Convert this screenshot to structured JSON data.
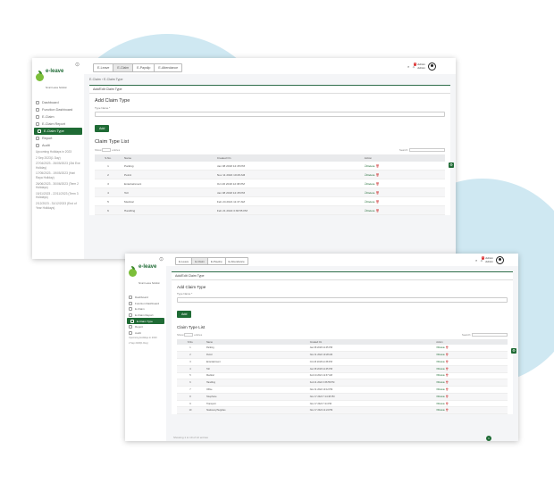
{
  "brand": {
    "name": "e-leave",
    "tagline": "Smart Leave Solution",
    "accent": "#1f6b35",
    "blob": "#cfe8f2"
  },
  "sidebar": {
    "items": [
      {
        "label": "Dashboard",
        "icon": "dashboard-icon"
      },
      {
        "label": "Function Dashboard",
        "icon": "clock-icon"
      },
      {
        "label": "E-Claim",
        "icon": "document-icon"
      },
      {
        "label": "E-Claim Report",
        "icon": "report-icon"
      },
      {
        "label": "E-Claim Type",
        "icon": "list-icon",
        "active": true
      },
      {
        "label": "Report",
        "icon": "chart-icon"
      },
      {
        "label": "Audit",
        "icon": "audit-icon"
      }
    ],
    "holiday_header": "Upcoming Holidays in 2023",
    "holidays": [
      "2 Sep 2023(1 Day)",
      "27/04/2023 - 26/05/2023 (Old Eve Holiday)",
      "17/05/2023 - 19/05/2023 (Hari Raya Holiday)",
      "26/06/2023 - 30/06/2023 (Term 2 Holidays)",
      "15/11/2023 - 22/11/2023 (Term 3 Holidays)",
      "2/12/2023 - 31/12/2023 (End of Year Holidays)"
    ]
  },
  "topbar": {
    "tabs": [
      "E-Leave",
      "E-Claim",
      "E-Payslip",
      "E-Attendance"
    ],
    "active_tab": 1,
    "search_icon": "search-icon",
    "bell_icon": "bell-icon",
    "badge": "1",
    "user_name": "Admin",
    "user_role": "Admin"
  },
  "breadcrumb": "E-Claim  ›  E-Claim Type",
  "card_header": "Add/Edit Claim Type",
  "form": {
    "title": "Add Claim Type",
    "field_label": "Type Name *",
    "add_button": "Add"
  },
  "list": {
    "title": "Claim Type List",
    "show_label": "Show",
    "show_value": "10",
    "entries_label": "entries",
    "search_label": "Search:",
    "columns": [
      "S.No.",
      "Name",
      "Created On",
      "Action"
    ],
    "action_edit": "Delete",
    "rows": [
      {
        "no": "1",
        "name": "Parking",
        "created": "Jan 08 2018 12:45 PM"
      },
      {
        "no": "2",
        "name": "Petrol",
        "created": "Nov 11 2022 10:28 AM"
      },
      {
        "no": "3",
        "name": "Entertainment",
        "created": "Oct 26 2018 12:38 PM"
      },
      {
        "no": "4",
        "name": "Toll",
        "created": "Jan 08 2018 12:45 PM"
      },
      {
        "no": "5",
        "name": "Medical",
        "created": "Feb 24 2021 11:37 AM"
      },
      {
        "no": "6",
        "name": "Handling",
        "created": "Feb 21 2022 3:36:55 PM"
      },
      {
        "no": "7",
        "name": "Office",
        "created": "Nov 11 2022 10:12 PM"
      },
      {
        "no": "8",
        "name": "Telephone",
        "created": "Nov 17 2022 7:14:38 PM"
      },
      {
        "no": "9",
        "name": "Transport",
        "created": "Nov 17 2022 7:24 PM"
      },
      {
        "no": "10",
        "name": "Stationery/Supplies",
        "created": "Nov 17 2022 11:24 PM"
      }
    ]
  },
  "pager": {
    "info": "Showing 1 to 10 of 12 entries",
    "page": "1"
  }
}
